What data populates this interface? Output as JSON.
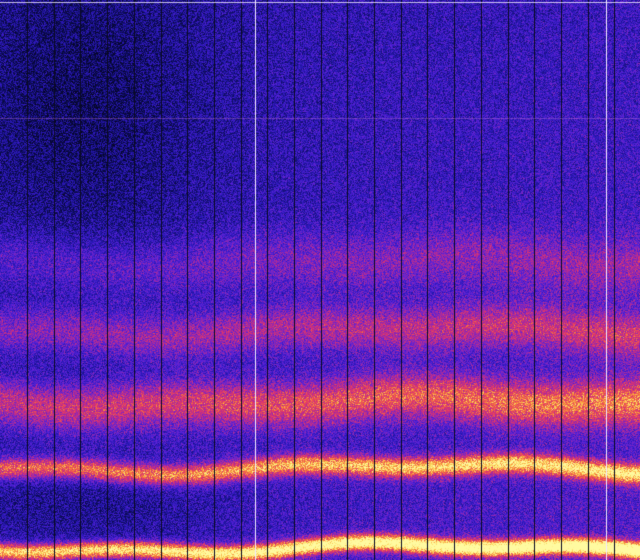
{
  "colormap": {
    "name": "magma-like",
    "stops": [
      "#000000",
      "#0c0c58",
      "#2a18b8",
      "#5a22d8",
      "#a62aa0",
      "#e0356a",
      "#f67a3a",
      "#fbd35a",
      "#fffaa0"
    ]
  },
  "spectrogram": {
    "background_color": "#140f6a",
    "band_colors": {
      "faint": "#b22a9a",
      "medium": "#f2445e",
      "strong": "#fbe36a"
    },
    "column_marker_color": "#0a0a24",
    "bright_marker_color": "#f0e8ff"
  }
}
